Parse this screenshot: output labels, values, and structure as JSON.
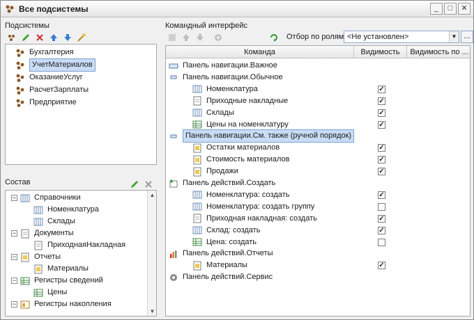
{
  "window": {
    "title": "Все подсистемы",
    "minimize": "_",
    "maximize": "□",
    "close": "✕"
  },
  "subsystems": {
    "label": "Подсистемы",
    "items": [
      {
        "label": "Бухгалтерия"
      },
      {
        "label": "УчетМатериалов",
        "selected": true
      },
      {
        "label": "ОказаниеУслуг"
      },
      {
        "label": "РасчетЗарплаты"
      },
      {
        "label": "Предприятие"
      }
    ]
  },
  "composition": {
    "label": "Состав",
    "items": [
      {
        "label": "Справочники",
        "level": 0
      },
      {
        "label": "Номенклатура",
        "level": 1
      },
      {
        "label": "Склады",
        "level": 1
      },
      {
        "label": "Документы",
        "level": 0
      },
      {
        "label": "ПриходнаяНакладная",
        "level": 1
      },
      {
        "label": "Отчеты",
        "level": 0
      },
      {
        "label": "Материалы",
        "level": 1
      },
      {
        "label": "Регистры сведений",
        "level": 0
      },
      {
        "label": "Цены",
        "level": 1
      },
      {
        "label": "Регистры накопления",
        "level": 0
      }
    ]
  },
  "command_interface": {
    "label": "Командный интерфейс",
    "filter_label": "Отбор по ролям:",
    "filter_value": "<Не установлен>",
    "dots": "...",
    "columns": {
      "command": "Команда",
      "visibility": "Видимость",
      "visibility_other": "Видимость по ..."
    },
    "rows": [
      {
        "label": "Панель навигации.Важное",
        "level": 0,
        "checked": null
      },
      {
        "label": "Панель навигации.Обычное",
        "level": 0,
        "checked": null
      },
      {
        "label": "Номенклатура",
        "level": 1,
        "checked": true
      },
      {
        "label": "Приходные накладные",
        "level": 1,
        "checked": true
      },
      {
        "label": "Склады",
        "level": 1,
        "checked": true
      },
      {
        "label": "Цены на номенклатуру",
        "level": 1,
        "checked": true
      },
      {
        "label": "Панель навигации.См. также (ручной порядок)",
        "level": 0,
        "checked": null,
        "selected": true
      },
      {
        "label": "Остатки материалов",
        "level": 1,
        "checked": true
      },
      {
        "label": "Стоимость материалов",
        "level": 1,
        "checked": true
      },
      {
        "label": "Продажи",
        "level": 1,
        "checked": true
      },
      {
        "label": "Панель действий.Создать",
        "level": 0,
        "checked": null
      },
      {
        "label": "Номенклатура: создать",
        "level": 1,
        "checked": true
      },
      {
        "label": "Номенклатура: создать группу",
        "level": 1,
        "checked": false
      },
      {
        "label": "Приходная накладная: создать",
        "level": 1,
        "checked": true
      },
      {
        "label": "Склад: создать",
        "level": 1,
        "checked": true
      },
      {
        "label": "Цена: создать",
        "level": 1,
        "checked": false
      },
      {
        "label": "Панель действий.Отчеты",
        "level": 0,
        "checked": null
      },
      {
        "label": "Материалы",
        "level": 1,
        "checked": true
      },
      {
        "label": "Панель действий.Сервис",
        "level": 0,
        "checked": null
      }
    ]
  }
}
